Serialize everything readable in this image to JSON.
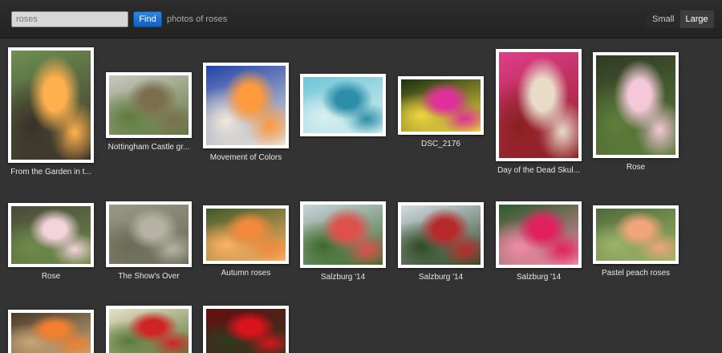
{
  "search": {
    "value": "roses",
    "placeholder": "",
    "button_label": "Find",
    "caption": "photos of roses"
  },
  "view_toggle": {
    "small_label": "Small",
    "large_label": "Large",
    "selected": "Large"
  },
  "photos": [
    {
      "title": "From the Garden in t...",
      "colors": [
        "#6e8f52",
        "#ffb04d",
        "#3a3028"
      ]
    },
    {
      "title": "Nottingham Castle gr...",
      "colors": [
        "#c9c8c0",
        "#7b6e4d",
        "#5f7a3e"
      ]
    },
    {
      "title": "Movement of Colors",
      "colors": [
        "#2244aa",
        "#ff9a3c",
        "#f0e8d8"
      ]
    },
    {
      "title": "",
      "colors": [
        "#6fc4d8",
        "#2d8ea8",
        "#d9f0f0"
      ]
    },
    {
      "title": "DSC_2176",
      "colors": [
        "#1a3010",
        "#e0309b",
        "#f2d640"
      ]
    },
    {
      "title": "Day of the Dead Skul...",
      "colors": [
        "#e03d8a",
        "#e8dcc8",
        "#8a1f1f"
      ]
    },
    {
      "title": "Rose",
      "colors": [
        "#2f3a23",
        "#f4c8d8",
        "#5e7f3b"
      ]
    },
    {
      "title": "Rose",
      "colors": [
        "#4a4a3a",
        "#f4d4dc",
        "#6e8c4a"
      ]
    },
    {
      "title": "The Show's Over",
      "colors": [
        "#9a9888",
        "#b5b2a4",
        "#6a6a55"
      ]
    },
    {
      "title": "Autumn roses",
      "colors": [
        "#3d5a28",
        "#f08a3a",
        "#ffb264"
      ]
    },
    {
      "title": "Salzburg '14",
      "colors": [
        "#c8d4dc",
        "#e0504a",
        "#3f6a2c"
      ]
    },
    {
      "title": "Salzburg '14",
      "colors": [
        "#d4dce4",
        "#b82a2a",
        "#2f4a25"
      ]
    },
    {
      "title": "Salzburg '14",
      "colors": [
        "#2a5a2a",
        "#e22060",
        "#f58aa8"
      ]
    },
    {
      "title": "Pastel peach roses",
      "colors": [
        "#4f6a3a",
        "#f2a57a",
        "#9cb468"
      ]
    },
    {
      "title": "",
      "colors": [
        "#4a3a2a",
        "#f08030",
        "#c8a878"
      ]
    },
    {
      "title": "",
      "colors": [
        "#e8e0c8",
        "#d02424",
        "#5a7a3a"
      ]
    },
    {
      "title": "",
      "colors": [
        "#6a0c10",
        "#d8141c",
        "#2e3a1e"
      ]
    }
  ]
}
